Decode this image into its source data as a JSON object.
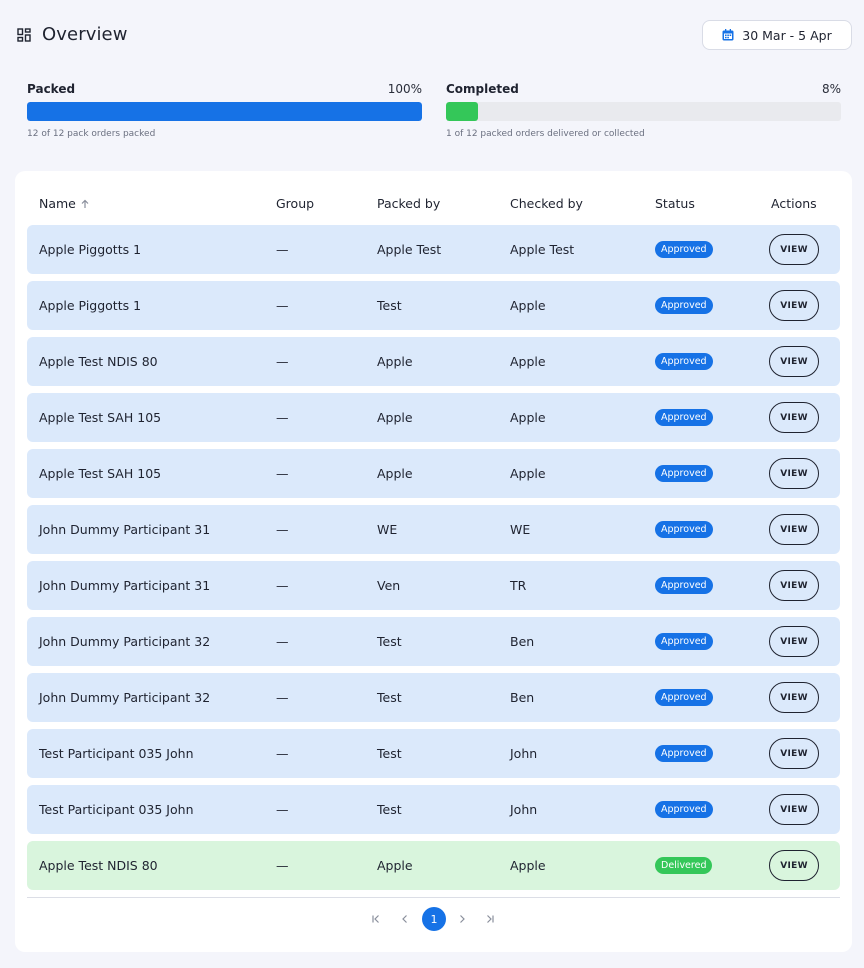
{
  "header": {
    "title": "Overview",
    "date_range": "30 Mar - 5 Apr"
  },
  "progress": {
    "packed": {
      "label": "Packed",
      "percent_text": "100%",
      "fraction": 1.0,
      "subtext": "12 of 12 pack orders packed",
      "color": "#1672e6"
    },
    "completed": {
      "label": "Completed",
      "percent_text": "8%",
      "fraction": 0.08,
      "subtext": "1 of 12 packed orders delivered or collected",
      "color": "#34c759"
    }
  },
  "table": {
    "columns": {
      "name": "Name",
      "group": "Group",
      "packed_by": "Packed by",
      "checked_by": "Checked by",
      "status": "Status",
      "actions": "Actions"
    },
    "view_label": "VIEW",
    "status_colors": {
      "Approved": "#1672e6",
      "Delivered": "#34c759"
    },
    "row_colors": {
      "Approved": "#dbe9fb",
      "Delivered": "#d9f5dd"
    },
    "rows": [
      {
        "name": "Apple Piggotts 1",
        "group": "—",
        "packed_by": "Apple Test",
        "checked_by": "Apple Test",
        "status": "Approved"
      },
      {
        "name": "Apple Piggotts 1",
        "group": "—",
        "packed_by": "Test",
        "checked_by": "Apple",
        "status": "Approved"
      },
      {
        "name": "Apple Test NDIS 80",
        "group": "—",
        "packed_by": "Apple",
        "checked_by": "Apple",
        "status": "Approved"
      },
      {
        "name": "Apple Test SAH 105",
        "group": "—",
        "packed_by": "Apple",
        "checked_by": "Apple",
        "status": "Approved"
      },
      {
        "name": "Apple Test SAH 105",
        "group": "—",
        "packed_by": "Apple",
        "checked_by": "Apple",
        "status": "Approved"
      },
      {
        "name": "John Dummy Participant 31",
        "group": "—",
        "packed_by": "WE",
        "checked_by": "WE",
        "status": "Approved"
      },
      {
        "name": "John Dummy Participant 31",
        "group": "—",
        "packed_by": "Ven",
        "checked_by": "TR",
        "status": "Approved"
      },
      {
        "name": "John Dummy Participant 32",
        "group": "—",
        "packed_by": "Test",
        "checked_by": "Ben",
        "status": "Approved"
      },
      {
        "name": "John Dummy Participant 32",
        "group": "—",
        "packed_by": "Test",
        "checked_by": "Ben",
        "status": "Approved"
      },
      {
        "name": "Test Participant 035 John",
        "group": "—",
        "packed_by": "Test",
        "checked_by": "John",
        "status": "Approved"
      },
      {
        "name": "Test Participant 035 John",
        "group": "—",
        "packed_by": "Test",
        "checked_by": "John",
        "status": "Approved"
      },
      {
        "name": "Apple Test NDIS 80",
        "group": "—",
        "packed_by": "Apple",
        "checked_by": "Apple",
        "status": "Delivered"
      }
    ]
  },
  "pagination": {
    "current_page": "1"
  }
}
